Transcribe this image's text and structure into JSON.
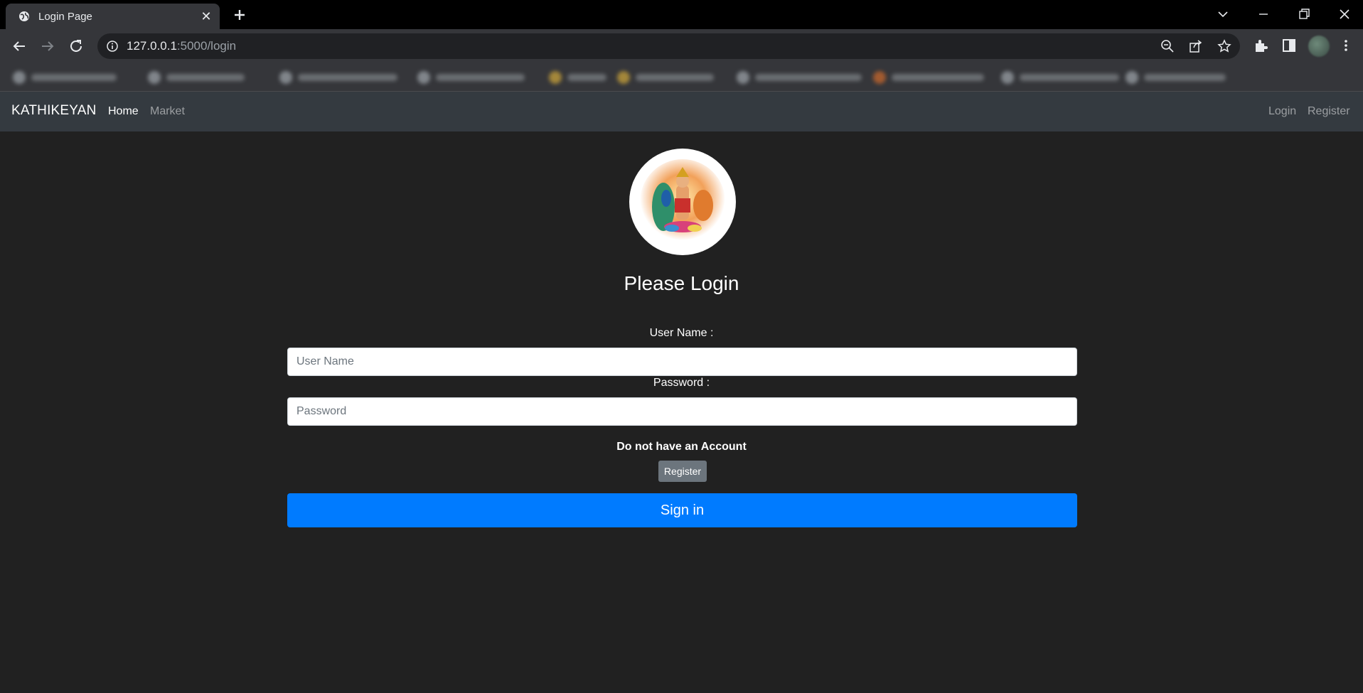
{
  "browser": {
    "tab_title": "Login Page",
    "url_host": "127.0.0.1",
    "url_rest": ":5000/login"
  },
  "navbar": {
    "brand": "KATHIKEYAN",
    "links": [
      "Home",
      "Market"
    ],
    "right_links": [
      "Login",
      "Register"
    ]
  },
  "login": {
    "heading": "Please Login",
    "username_label": "User Name :",
    "username_placeholder": "User Name",
    "password_label": "Password :",
    "password_placeholder": "Password",
    "no_account_text": "Do not have an Account",
    "register_button": "Register",
    "signin_button": "Sign in"
  },
  "colors": {
    "page_background": "#212121",
    "navbar_background": "#343a40",
    "primary": "#007bff",
    "secondary": "#6c757d"
  },
  "icons": [
    "globe-icon",
    "close-icon",
    "plus-icon",
    "back-icon",
    "forward-icon",
    "reload-icon",
    "info-icon",
    "zoom-icon",
    "share-icon",
    "star-icon",
    "puzzle-icon",
    "side-panel-icon",
    "kebab-menu-icon"
  ]
}
